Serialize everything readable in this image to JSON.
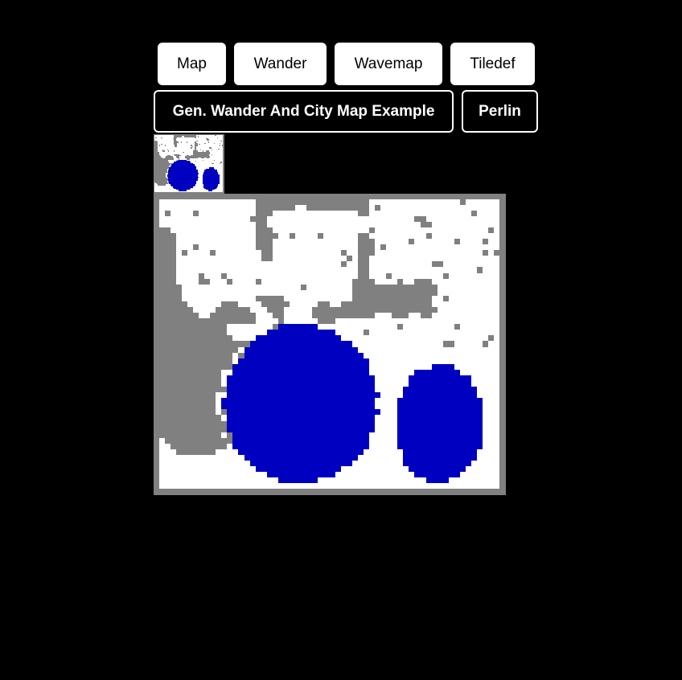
{
  "nav": {
    "map_label": "Map",
    "wander_label": "Wander",
    "wavemap_label": "Wavemap",
    "tiledef_label": "Tiledef",
    "gen_wander_city_label": "Gen. Wander And City Map Example",
    "perlin_label": "Perlin"
  },
  "map": {
    "grid_cols": 62,
    "grid_rows": 53,
    "tiles": {
      "floor_color": "#ffffff",
      "wall_color": "#808080",
      "water_color": "#0000c0",
      "background_color": "#000000"
    }
  }
}
